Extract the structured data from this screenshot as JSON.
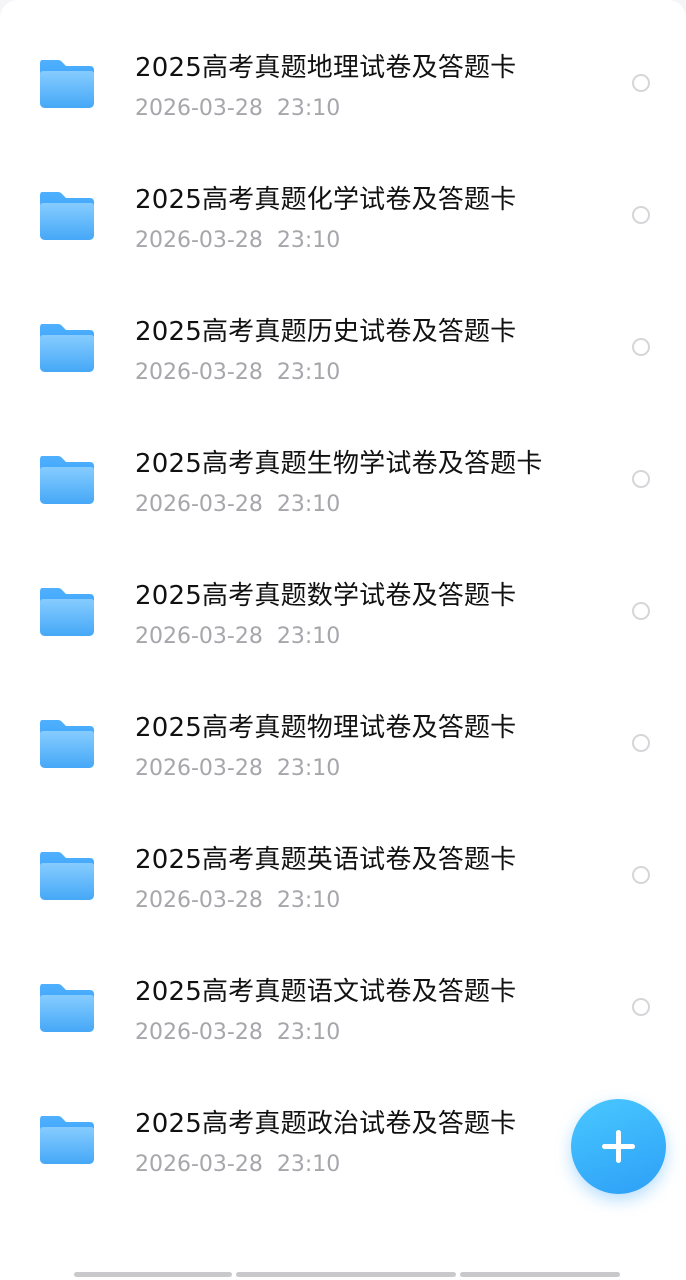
{
  "files": [
    {
      "name": "2025高考真题地理试卷及答题卡",
      "date": "2026-03-28  23:10",
      "icon": "folder-icon"
    },
    {
      "name": "2025高考真题化学试卷及答题卡",
      "date": "2026-03-28  23:10",
      "icon": "folder-icon"
    },
    {
      "name": "2025高考真题历史试卷及答题卡",
      "date": "2026-03-28  23:10",
      "icon": "folder-icon"
    },
    {
      "name": "2025高考真题生物学试卷及答题卡",
      "date": "2026-03-28  23:10",
      "icon": "folder-icon"
    },
    {
      "name": "2025高考真题数学试卷及答题卡",
      "date": "2026-03-28  23:10",
      "icon": "folder-icon"
    },
    {
      "name": "2025高考真题物理试卷及答题卡",
      "date": "2026-03-28  23:10",
      "icon": "folder-icon"
    },
    {
      "name": "2025高考真题英语试卷及答题卡",
      "date": "2026-03-28  23:10",
      "icon": "folder-icon"
    },
    {
      "name": "2025高考真题语文试卷及答题卡",
      "date": "2026-03-28  23:10",
      "icon": "folder-icon"
    },
    {
      "name": "2025高考真题政治试卷及答题卡",
      "date": "2026-03-28  23:10",
      "icon": "folder-icon"
    }
  ],
  "fab": {
    "icon": "plus-icon"
  },
  "colors": {
    "folder_top": "#7cc6ff",
    "folder_bottom": "#3aa0f5",
    "accent": "#2d9ff7",
    "title_text": "#111111",
    "date_text": "#a6a6ab",
    "radio_border": "#d6d6da"
  }
}
